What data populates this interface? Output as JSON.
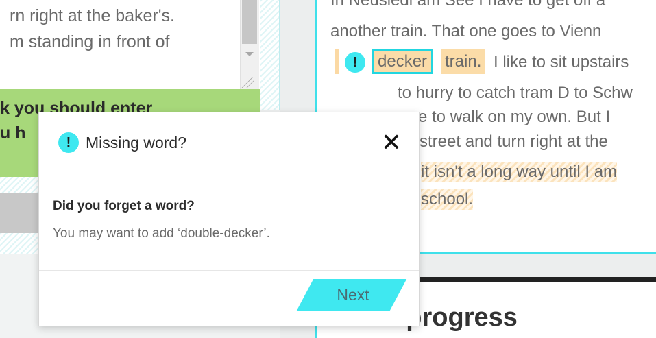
{
  "left_panel": {
    "lines": [
      "rn right at the baker's.",
      "m standing in front of"
    ]
  },
  "green_banner": {
    "line1": "k you should enter",
    "line2": "u h"
  },
  "text_panel": {
    "line0": "In Neusiedl am See I have to get off a",
    "line1": "another train. That one goes to Vienn",
    "issue_marker": "!",
    "word_decker": "decker",
    "word_train": "train.",
    "line2_rest": "I like to sit upstairs",
    "line3": "to hurry to catch tram D to Schw",
    "line4": "ve to walk on my own. But I",
    "line5": "street and turn right at the",
    "line6": "it isn't a long way until I am",
    "line7": "school."
  },
  "progress": {
    "title": "Your progress"
  },
  "popup": {
    "icon_glyph": "!",
    "title": "Missing word?",
    "close_glyph": "✕",
    "heading": "Did you forget a word?",
    "suggestion": "You may want to add ‘double-decker’.",
    "next_label": "Next"
  },
  "colors": {
    "accent": "#3fe8f0",
    "highlight": "#fbdca8",
    "green_banner": "#a7d87a"
  }
}
